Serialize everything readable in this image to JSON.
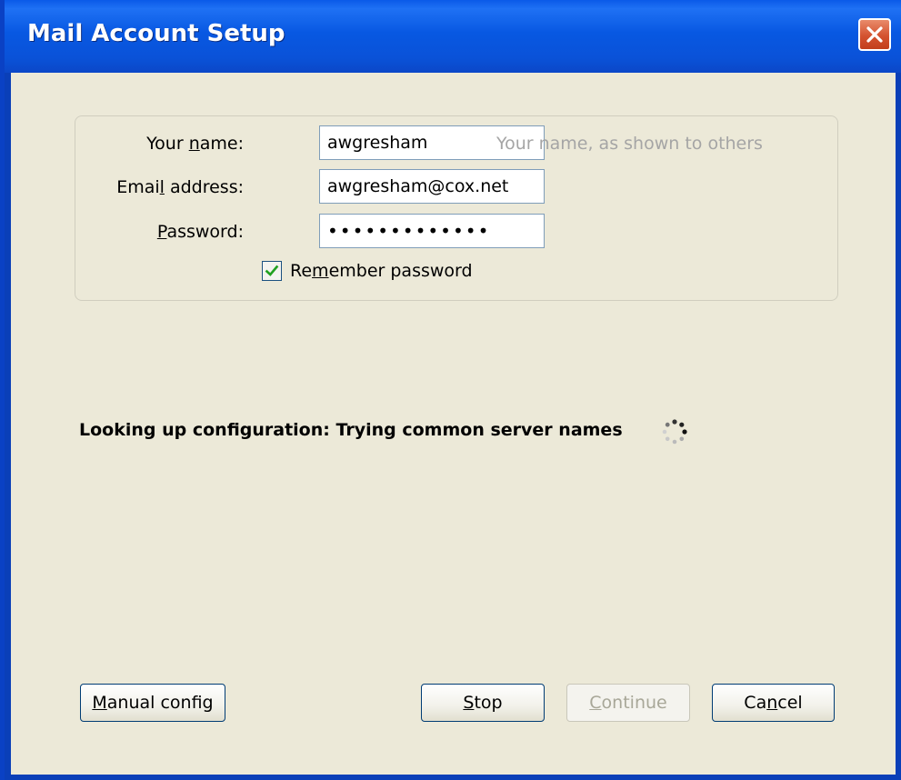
{
  "dialog": {
    "title": "Mail Account Setup"
  },
  "form": {
    "name_label_pre": "Your ",
    "name_label_u": "n",
    "name_label_post": "ame:",
    "name_value": "awgresham",
    "name_hint": "Your name, as shown to others",
    "email_label_pre": "Emai",
    "email_label_u": "l",
    "email_label_post": " address:",
    "email_value": "awgresham@cox.net",
    "password_label_u": "P",
    "password_label_post": "assword:",
    "password_mask": "•••••••••••••",
    "remember_pre": "Re",
    "remember_u": "m",
    "remember_post": "ember password",
    "remember_checked": true
  },
  "status": {
    "text": "Looking up configuration: Trying common server names"
  },
  "buttons": {
    "manual_u": "M",
    "manual_post": "anual config",
    "stop_u": "S",
    "stop_post": "top",
    "continue_u": "C",
    "continue_post": "ontinue",
    "cancel_pre": "Ca",
    "cancel_u": "n",
    "cancel_post": "cel"
  },
  "colors": {
    "titlebar": "#0a52d8",
    "client": "#ece9d8",
    "hint": "#a5a5a5",
    "check": "#21a121"
  }
}
